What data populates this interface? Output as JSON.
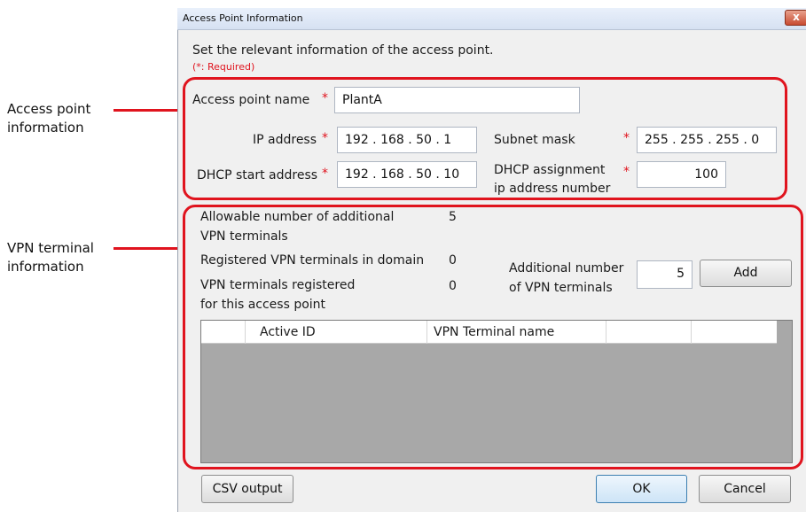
{
  "window": {
    "title": "Access Point Information",
    "close_glyph": "x"
  },
  "callouts": {
    "access_point_line1": "Access point",
    "access_point_line2": "information",
    "vpn_line1": "VPN terminal",
    "vpn_line2": "information"
  },
  "intro": {
    "instruction": "Set the relevant information of the access point.",
    "required_note": "(*: Required)"
  },
  "required_mark": "*",
  "access_point": {
    "name_label": "Access point name",
    "name_value": "PlantA",
    "ip_label": "IP address",
    "ip_value": "192 . 168 . 50 . 1",
    "subnet_label": "Subnet mask",
    "subnet_value": "255 . 255 . 255 . 0",
    "dhcp_start_label": "DHCP start address",
    "dhcp_start_value": "192 . 168 . 50 . 10",
    "dhcp_count_label_line1": "DHCP assignment",
    "dhcp_count_label_line2": "ip address number",
    "dhcp_count_value": "100"
  },
  "vpn": {
    "allowable_label_line1": "Allowable number of additional",
    "allowable_label_line2": "VPN terminals",
    "allowable_value": "5",
    "registered_domain_label": "Registered VPN terminals in domain",
    "registered_domain_value": "0",
    "registered_ap_label_line1": "VPN terminals registered",
    "registered_ap_label_line2": "for this access point",
    "registered_ap_value": "0",
    "additional_label_line1": "Additional number",
    "additional_label_line2": "of VPN terminals",
    "additional_value": "5",
    "add_button": "Add",
    "table_headers": [
      "Active ID",
      "VPN Terminal name"
    ]
  },
  "footer": {
    "csv_button": "CSV output",
    "ok_button": "OK",
    "cancel_button": "Cancel"
  },
  "colors": {
    "callout_red": "#e0141e",
    "grid_empty": "#a8a8a8",
    "ok_border": "#3c7fb1"
  }
}
